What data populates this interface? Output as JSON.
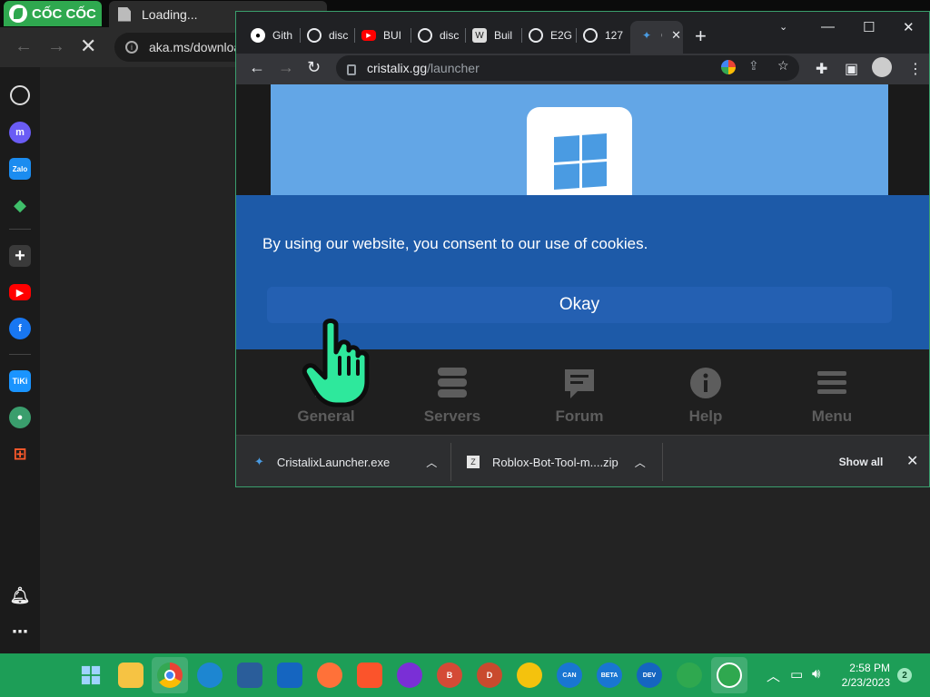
{
  "background_browser": {
    "brand": "CỐC CỐC",
    "tab_title": "Loading...",
    "url": "aka.ms/downloa"
  },
  "chrome": {
    "tabs": [
      {
        "label": "Gith",
        "icon": "github-icon"
      },
      {
        "label": "disc",
        "icon": "globe-icon"
      },
      {
        "label": "BUI",
        "icon": "youtube-icon"
      },
      {
        "label": "disc",
        "icon": "globe-icon"
      },
      {
        "label": "Buil",
        "icon": "wolf-icon"
      },
      {
        "label": "E2G",
        "icon": "globe-icon"
      },
      {
        "label": "127",
        "icon": "globe-icon"
      },
      {
        "label": "C",
        "icon": "cristalix-icon"
      }
    ],
    "url": {
      "domain": "cristalix.gg",
      "path": "/launcher"
    }
  },
  "page": {
    "cookie_text": "By using our website, you consent to our use of cookies.",
    "okay_label": "Okay",
    "nav": [
      {
        "label": "General",
        "icon": "home-icon"
      },
      {
        "label": "Servers",
        "icon": "server-icon"
      },
      {
        "label": "Forum",
        "icon": "forum-icon"
      },
      {
        "label": "Help",
        "icon": "info-icon"
      },
      {
        "label": "Menu",
        "icon": "menu-icon"
      }
    ]
  },
  "downloads": {
    "items": [
      {
        "name": "CristalixLauncher.exe"
      },
      {
        "name": "Roblox-Bot-Tool-m....zip"
      }
    ],
    "show_all": "Show all"
  },
  "taskbar": {
    "time": "2:58 PM",
    "date": "2/23/2023",
    "notifications": "2"
  },
  "colors": {
    "accent_green": "#1d9e57",
    "cookie_banner": "#1d5aa8",
    "hero_blue": "#63a6e6"
  }
}
